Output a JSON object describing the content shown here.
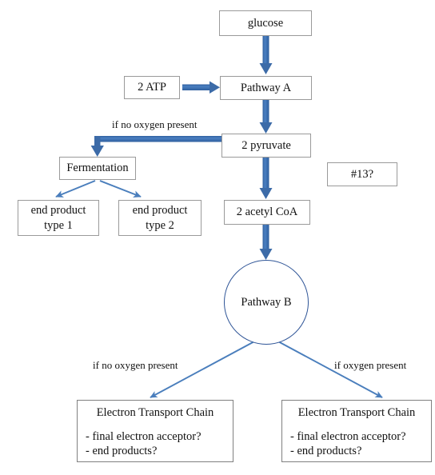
{
  "diagram": {
    "title": "Cellular respiration pathway flowchart",
    "colors": {
      "thick_arrow": "#3c6ba8",
      "thin_arrow": "#4a7ebc",
      "circle_stroke": "#2f5597",
      "box_border": "#9a9a9a",
      "text": "#111111",
      "background": "#ffffff"
    },
    "nodes": {
      "glucose": {
        "label": "glucose"
      },
      "two_atp": {
        "label": "2 ATP"
      },
      "pathway_a": {
        "label": "Pathway A"
      },
      "two_pyruvate": {
        "label": "2 pyruvate"
      },
      "question_13": {
        "label": "#13?"
      },
      "fermentation": {
        "label": "Fermentation"
      },
      "end_product_1": {
        "line1": "end product",
        "line2": "type 1"
      },
      "end_product_2": {
        "line1": "end product",
        "line2": "type 2"
      },
      "two_acetyl_coa": {
        "label": "2 acetyl CoA"
      },
      "pathway_b": {
        "label": "Pathway B"
      },
      "etc_left": {
        "title": "Electron Transport Chain",
        "item1": "- final electron acceptor?",
        "item2": "- end products?"
      },
      "etc_right": {
        "title": "Electron Transport Chain",
        "item1": "- final electron acceptor?",
        "item2": "- end products?"
      }
    },
    "edge_labels": {
      "no_oxygen_top": "if no oxygen present",
      "no_oxygen_bottom": "if no oxygen present",
      "oxygen_bottom": "if oxygen present"
    }
  },
  "chart_data": {
    "type": "diagram",
    "title": "Cellular respiration pathway flowchart",
    "nodes": [
      {
        "id": "glucose",
        "label": "glucose",
        "shape": "rect"
      },
      {
        "id": "two_atp",
        "label": "2 ATP",
        "shape": "rect"
      },
      {
        "id": "pathway_a",
        "label": "Pathway A",
        "shape": "rect"
      },
      {
        "id": "two_pyruvate",
        "label": "2 pyruvate",
        "shape": "rect"
      },
      {
        "id": "question_13",
        "label": "#13?",
        "shape": "rect"
      },
      {
        "id": "fermentation",
        "label": "Fermentation",
        "shape": "rect"
      },
      {
        "id": "end_product_1",
        "label": "end product type 1",
        "shape": "rect"
      },
      {
        "id": "end_product_2",
        "label": "end product type 2",
        "shape": "rect"
      },
      {
        "id": "two_acetyl_coa",
        "label": "2 acetyl CoA",
        "shape": "rect"
      },
      {
        "id": "pathway_b",
        "label": "Pathway B",
        "shape": "circle"
      },
      {
        "id": "etc_left",
        "label": "Electron Transport Chain",
        "shape": "rect"
      },
      {
        "id": "etc_right",
        "label": "Electron Transport Chain",
        "shape": "rect"
      }
    ],
    "edges": [
      {
        "from": "glucose",
        "to": "pathway_a",
        "label": "",
        "style": "thick"
      },
      {
        "from": "two_atp",
        "to": "pathway_a",
        "label": "",
        "style": "thick"
      },
      {
        "from": "pathway_a",
        "to": "two_pyruvate",
        "label": "",
        "style": "thick"
      },
      {
        "from": "two_pyruvate",
        "to": "fermentation",
        "label": "if no oxygen present",
        "style": "thick-elbow"
      },
      {
        "from": "fermentation",
        "to": "end_product_1",
        "label": "",
        "style": "thin"
      },
      {
        "from": "fermentation",
        "to": "end_product_2",
        "label": "",
        "style": "thin"
      },
      {
        "from": "two_pyruvate",
        "to": "two_acetyl_coa",
        "label": "",
        "style": "thick"
      },
      {
        "from": "two_acetyl_coa",
        "to": "pathway_b",
        "label": "",
        "style": "thick"
      },
      {
        "from": "pathway_b",
        "to": "etc_left",
        "label": "if no oxygen present",
        "style": "thin"
      },
      {
        "from": "pathway_b",
        "to": "etc_right",
        "label": "if oxygen present",
        "style": "thin"
      }
    ]
  }
}
